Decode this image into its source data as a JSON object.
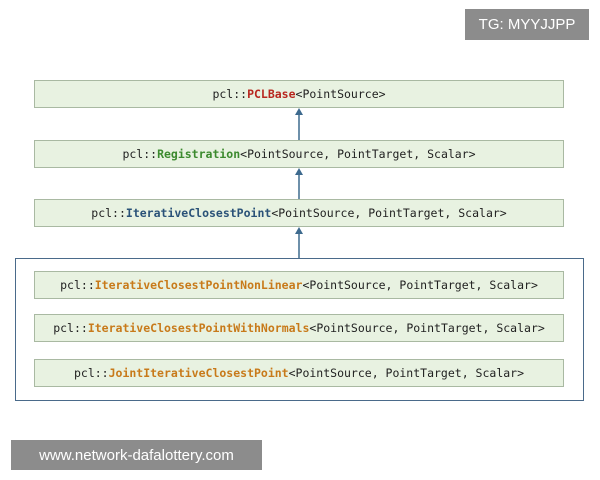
{
  "watermarks": {
    "top": "TG: MYYJJPP",
    "bottom": "www.network-dafalottery.com"
  },
  "colors": {
    "box_fill": "#e8f2e1",
    "box_border": "#a9b9a2",
    "arrow": "#3d6a8e",
    "group_border": "#4a6a8a",
    "pclbase_class": "#b8271f",
    "registration_class": "#3c8a2e",
    "icp_class": "#2a5278",
    "subclass_class": "#c87a1a"
  },
  "nodes": {
    "pclbase": {
      "ns": "pcl::",
      "cls": "PCLBase",
      "tpl": "<PointSource>"
    },
    "registration": {
      "ns": "pcl::",
      "cls": "Registration",
      "tpl": "<PointSource, PointTarget, Scalar>"
    },
    "icp": {
      "ns": "pcl::",
      "cls": "IterativeClosestPoint",
      "tpl": "<PointSource, PointTarget, Scalar>"
    },
    "icp_nonlinear": {
      "ns": "pcl::",
      "cls": "IterativeClosestPointNonLinear",
      "tpl": "<PointSource, PointTarget, Scalar>"
    },
    "icp_with_normals": {
      "ns": "pcl::",
      "cls": "IterativeClosestPointWithNormals",
      "tpl": "<PointSource, PointTarget, Scalar>"
    },
    "joint_icp": {
      "ns": "pcl::",
      "cls": "JointIterativeClosestPoint",
      "tpl": "<PointSource, PointTarget, Scalar>"
    }
  }
}
